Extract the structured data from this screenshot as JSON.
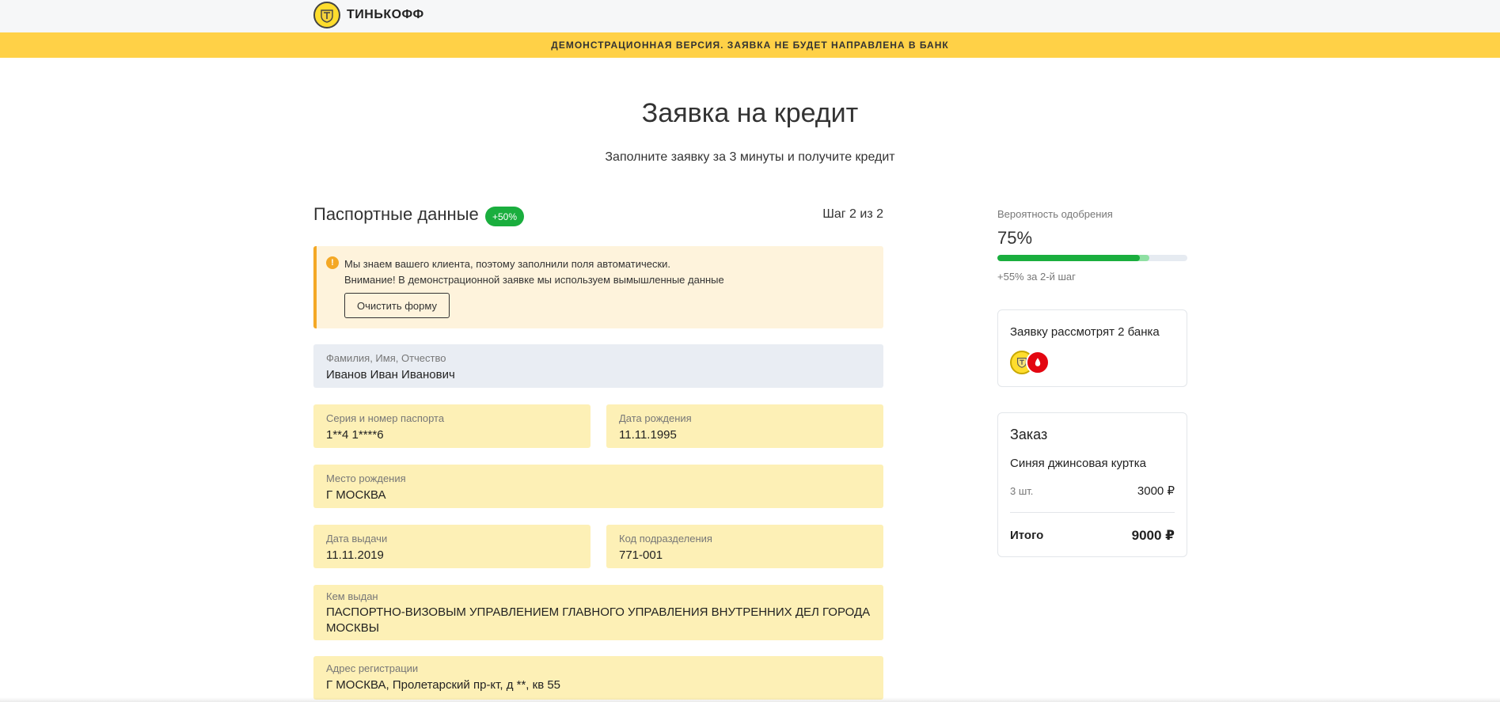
{
  "header": {
    "brand_name": "ТИНЬКОФФ",
    "logo_icon": "tinkoff-emblem-icon"
  },
  "banner": {
    "text": "ДЕМОНСТРАЦИОННАЯ ВЕРСИЯ. ЗАЯВКА НЕ БУДЕТ НАПРАВЛЕНА В БАНК",
    "color": "#ffd147"
  },
  "page": {
    "title": "Заявка на кредит",
    "subtitle": "Заполните заявку за 3 минуты и получите кредит"
  },
  "section": {
    "title": "Паспортные данные",
    "badge": "+50%",
    "step": "Шаг 2 из 2"
  },
  "notice": {
    "icon": "warning-icon",
    "line1": "Мы знаем вашего клиента, поэтому заполнили поля автоматически.",
    "line2": "Внимание! В демонстрационной заявке мы используем вымышленные данные",
    "button_label": "Очистить форму"
  },
  "form": {
    "full_name": {
      "label": "Фамилия, Имя, Отчество",
      "value": "Иванов Иван Иванович"
    },
    "passport": {
      "label": "Серия и номер паспорта",
      "value": "1**4 1****6"
    },
    "birth_date": {
      "label": "Дата рождения",
      "value": "11.11.1995"
    },
    "birth_place": {
      "label": "Место рождения",
      "value": "Г МОСКВА"
    },
    "issue_date": {
      "label": "Дата выдачи",
      "value": "11.11.2019"
    },
    "division_code": {
      "label": "Код подразделения",
      "value": "771-001"
    },
    "issued_by": {
      "label": "Кем выдан",
      "value": "ПАСПОРТНО-ВИЗОВЫМ УПРАВЛЕНИЕМ ГЛАВНОГО УПРАВЛЕНИЯ ВНУТРЕННИХ ДЕЛ ГОРОДА МОСКВЫ"
    },
    "registration_address": {
      "label": "Адрес регистрации",
      "value": "Г МОСКВА, Пролетарский пр-кт, д **, кв 55"
    }
  },
  "approval": {
    "label": "Вероятность одобрения",
    "percent_text": "75%",
    "progress": 0.75,
    "progress_with_step": 0.8,
    "note": "+55% за 2-й шаг",
    "accent_color": "#1aae3e"
  },
  "banks": {
    "title": "Заявку рассмотрят 2 банка",
    "logos": [
      "tinkoff-bank-icon",
      "mts-bank-icon"
    ]
  },
  "order": {
    "title": "Заказ",
    "item_name": "Синяя джинсовая куртка",
    "quantity": "3 шт.",
    "price": "3000 ₽",
    "total_label": "Итого",
    "total_value": "9000 ₽"
  }
}
